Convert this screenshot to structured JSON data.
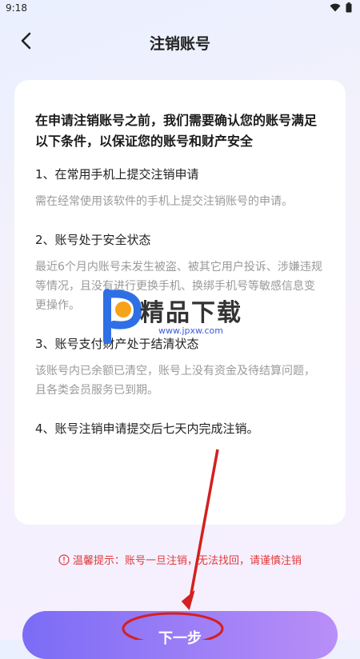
{
  "status_bar": {
    "time": "9:18"
  },
  "header": {
    "title": "注销账号"
  },
  "card": {
    "intro": "在申请注销账号之前，我们需要确认您的账号满足以下条件，以保证您的账号和财产安全",
    "conditions": [
      {
        "title": "1、在常用手机上提交注销申请",
        "desc": "需在经常使用该软件的手机上提交注销账号的申请。"
      },
      {
        "title": "2、账号处于安全状态",
        "desc": "最近6个月内账号未发生被盗、被其它用户投诉、涉嫌违规等情况，且没有进行更换手机、换绑手机号等敏感信息变更操作。"
      },
      {
        "title": "3、账号支付财产处于结清状态",
        "desc": "该账号内已余额已清空，账号上没有资金及待结算问题，且各类会员服务已到期。"
      },
      {
        "title": "4、账号注销申请提交后七天内完成注销。",
        "desc": ""
      }
    ]
  },
  "watermark": {
    "text": "精品下载",
    "url": "www.jpxw.com"
  },
  "tip": {
    "text": "温馨提示：账号一旦注销，无法找回，请谨慎注销"
  },
  "next_button": {
    "label": "下一步"
  },
  "colors": {
    "accent": "#7b6cf6",
    "warning": "#e03a3a",
    "annotation": "#d42020"
  },
  "icons": {
    "back": "chevron-left-icon",
    "tip": "info-circle-icon",
    "wifi": "wifi-icon",
    "battery": "battery-icon"
  }
}
